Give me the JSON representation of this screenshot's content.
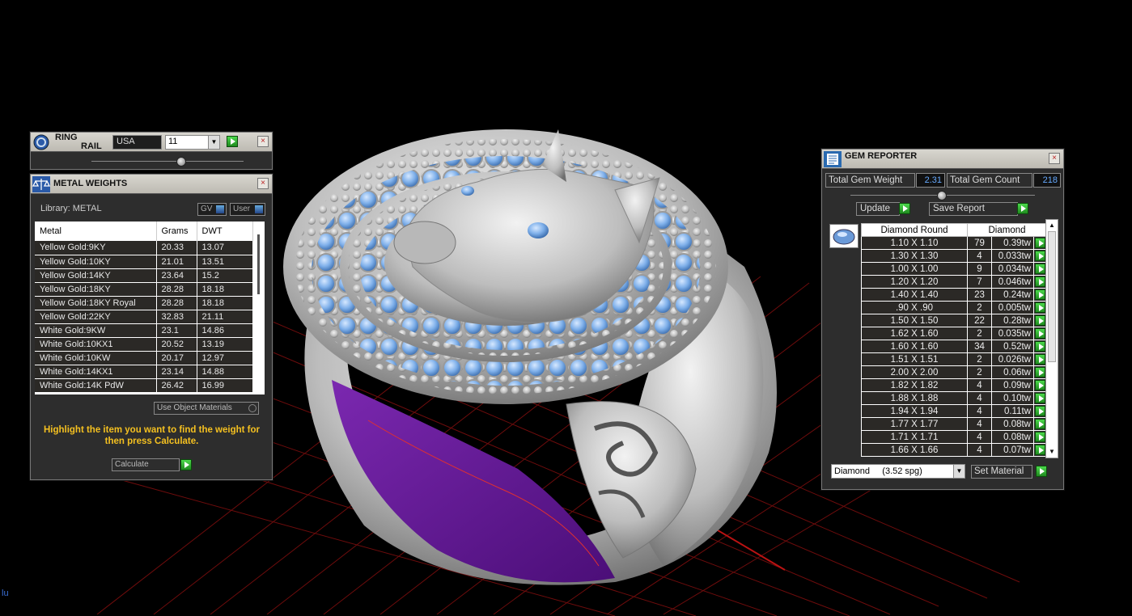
{
  "colors": {
    "background": "#000000",
    "grid": "#7a0e0e",
    "metal": "#c9c9c9",
    "gem": "#7fb0ea",
    "inner_band": "#6b1a98",
    "highlight_text": "#f4c020",
    "value_text": "#66aaff"
  },
  "ring_rail": {
    "title_line1": "RING",
    "title_line2": "RAIL",
    "country": "USA",
    "size": "11",
    "close": "×"
  },
  "metal_weights": {
    "title": "METAL WEIGHTS",
    "library_label": "Library: METAL",
    "gv_toggle": "GV",
    "user_toggle": "User",
    "columns": [
      "Metal",
      "Grams",
      "DWT"
    ],
    "rows": [
      [
        "Yellow Gold:9KY",
        "20.33",
        "13.07"
      ],
      [
        "Yellow Gold:10KY",
        "21.01",
        "13.51"
      ],
      [
        "Yellow Gold:14KY",
        "23.64",
        "15.2"
      ],
      [
        "Yellow Gold:18KY",
        "28.28",
        "18.18"
      ],
      [
        "Yellow Gold:18KY Royal",
        "28.28",
        "18.18"
      ],
      [
        "Yellow Gold:22KY",
        "32.83",
        "21.11"
      ],
      [
        "White Gold:9KW",
        "23.1",
        "14.86"
      ],
      [
        "White Gold:10KX1",
        "20.52",
        "13.19"
      ],
      [
        "White Gold:10KW",
        "20.17",
        "12.97"
      ],
      [
        "White Gold:14KX1",
        "23.14",
        "14.88"
      ],
      [
        "White Gold:14K PdW",
        "26.42",
        "16.99"
      ]
    ],
    "use_object_materials": "Use Object Materials",
    "instruction": "Highlight the item you want to find the weight for then press Calculate.",
    "calculate": "Calculate",
    "close": "×"
  },
  "gem_reporter": {
    "title": "GEM REPORTER",
    "total_weight_label": "Total Gem Weight",
    "total_weight": "2.31",
    "total_count_label": "Total Gem Count",
    "total_count": "218",
    "update": "Update",
    "save_report": "Save Report",
    "columns": [
      "Diamond Round",
      "Diamond"
    ],
    "rows": [
      [
        "1.10 X 1.10",
        "79",
        "0.39tw"
      ],
      [
        "1.30 X 1.30",
        "4",
        "0.033tw"
      ],
      [
        "1.00 X 1.00",
        "9",
        "0.034tw"
      ],
      [
        "1.20 X 1.20",
        "7",
        "0.046tw"
      ],
      [
        "1.40 X 1.40",
        "23",
        "0.24tw"
      ],
      [
        ".90 X .90",
        "2",
        "0.005tw"
      ],
      [
        "1.50 X 1.50",
        "22",
        "0.28tw"
      ],
      [
        "1.62 X 1.60",
        "2",
        "0.035tw"
      ],
      [
        "1.60 X 1.60",
        "34",
        "0.52tw"
      ],
      [
        "1.51 X 1.51",
        "2",
        "0.026tw"
      ],
      [
        "2.00 X 2.00",
        "2",
        "0.06tw"
      ],
      [
        "1.82 X 1.82",
        "4",
        "0.09tw"
      ],
      [
        "1.88 X 1.88",
        "4",
        "0.10tw"
      ],
      [
        "1.94 X 1.94",
        "4",
        "0.11tw"
      ],
      [
        "1.77 X 1.77",
        "4",
        "0.08tw"
      ],
      [
        "1.71 X 1.71",
        "4",
        "0.08tw"
      ],
      [
        "1.66 X 1.66",
        "4",
        "0.07tw"
      ]
    ],
    "material": "Diamond     (3.52 spg)",
    "set_material": "Set Material",
    "close": "×"
  }
}
